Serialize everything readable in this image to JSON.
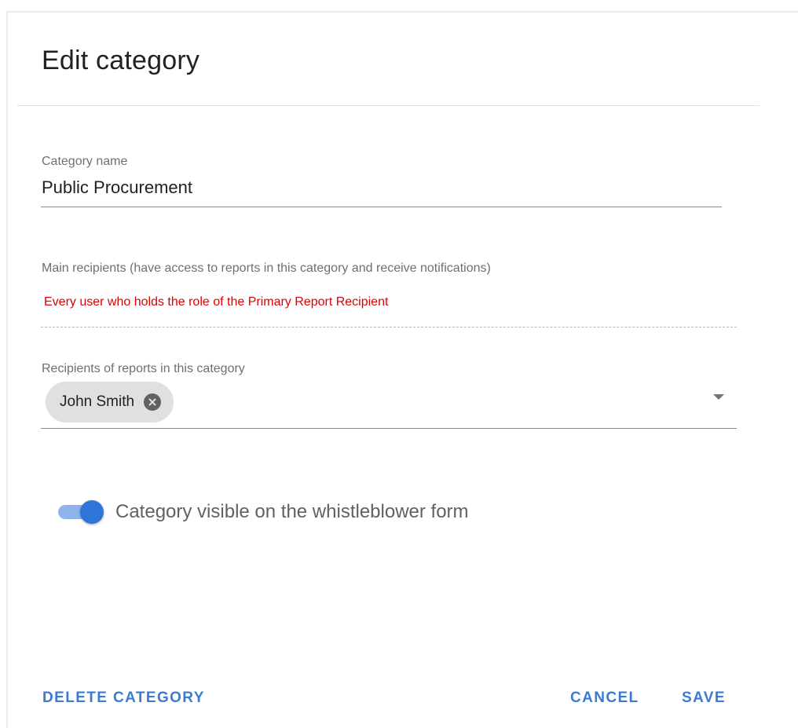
{
  "dialog": {
    "title": "Edit category"
  },
  "category_name": {
    "label": "Category name",
    "value": "Public Procurement"
  },
  "main_recipients": {
    "label": "Main recipients (have access to reports in this category and receive notifications)",
    "notice": "Every user who holds the role of the Primary Report Recipient"
  },
  "recipients": {
    "label": "Recipients of reports in this category",
    "chips": [
      {
        "label": "John Smith"
      }
    ]
  },
  "visibility_toggle": {
    "label": "Category visible on the whistleblower form",
    "checked": true
  },
  "actions": {
    "delete_label": "DELETE CATEGORY",
    "cancel_label": "CANCEL",
    "save_label": "SAVE"
  },
  "colors": {
    "accent": "#3a7bd5",
    "notice": "#e00000",
    "toggle_knob": "#2f74d8",
    "toggle_track": "#8fb3ec",
    "chip_bg": "#e0e0e0"
  }
}
